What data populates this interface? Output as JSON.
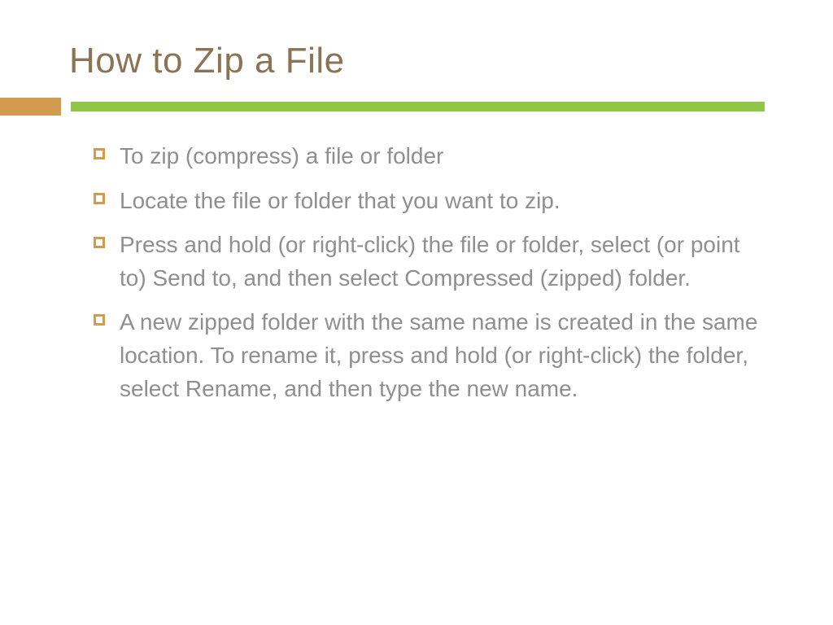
{
  "slide": {
    "title": "How to Zip a File",
    "bullets": [
      "To zip (compress) a file or folder",
      "Locate the file or folder that you want to zip.",
      "Press and hold (or right-click) the file or folder, select (or point to) Send to, and then select Compressed (zipped) folder.",
      "A new zipped folder with the same name is created in the same location. To rename it, press and hold (or right-click) the folder, select Rename, and then type the new name."
    ]
  },
  "colors": {
    "title": "#8b7355",
    "body": "#8f8f8f",
    "accent_orange": "#d39b50",
    "accent_green": "#8fc744"
  }
}
